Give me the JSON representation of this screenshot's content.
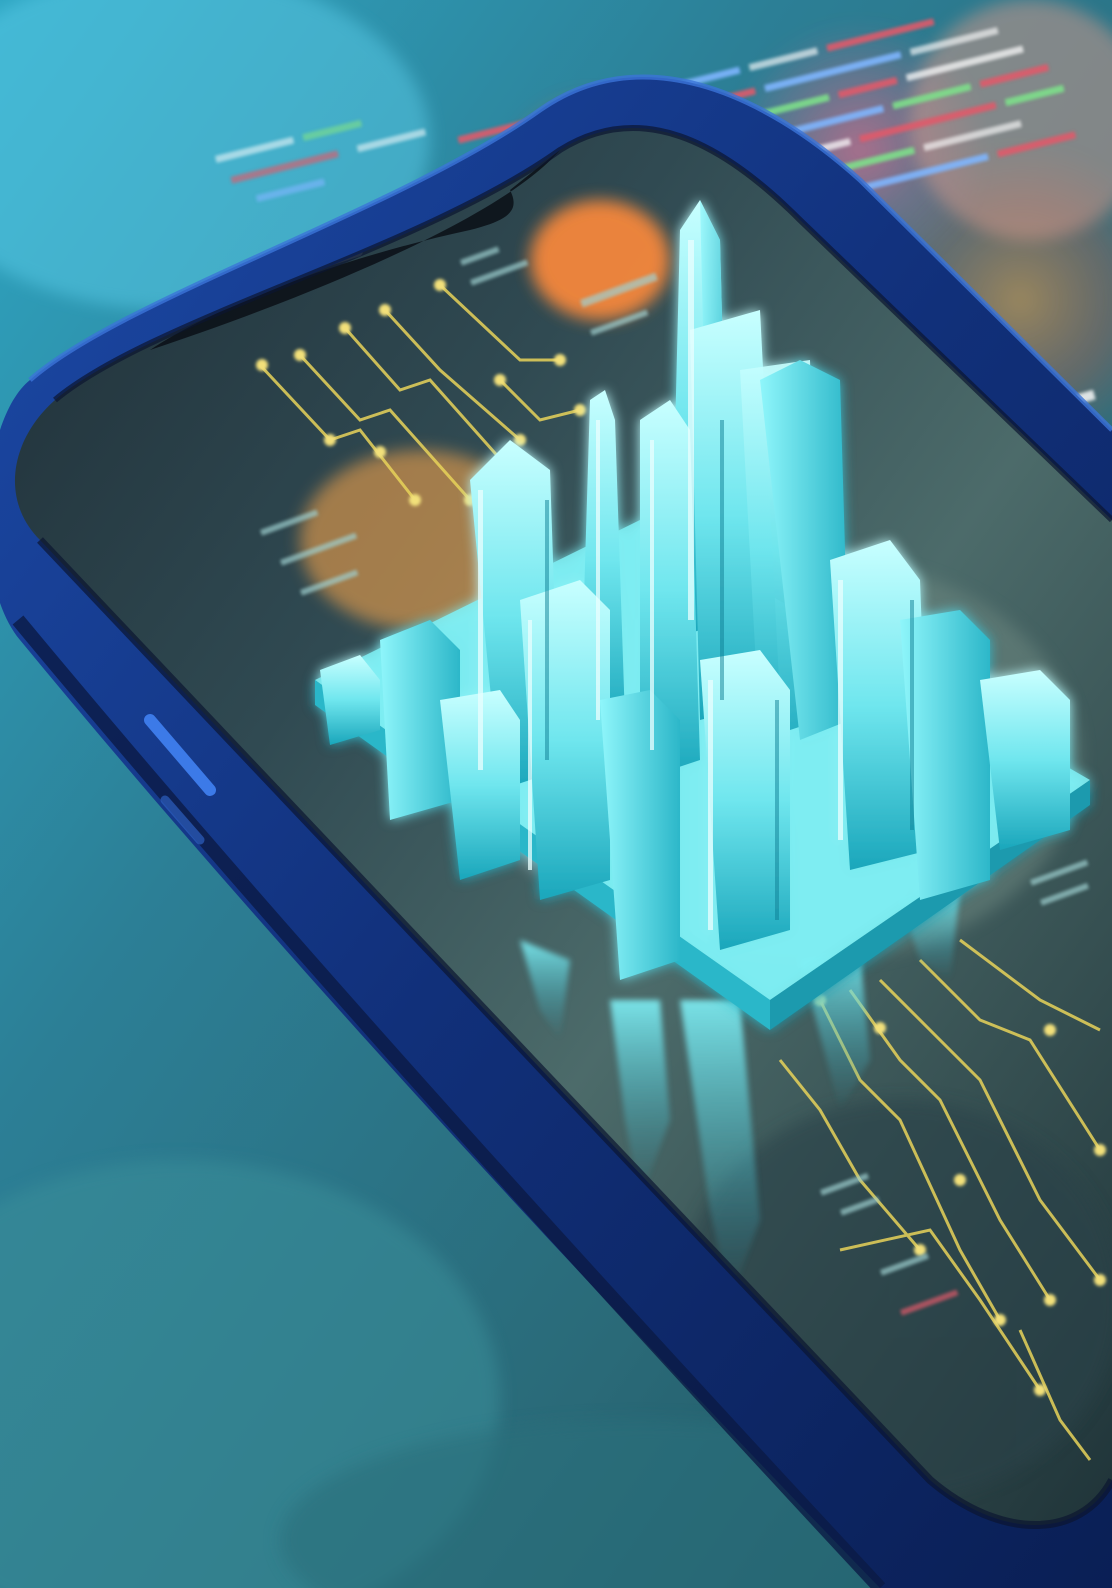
{
  "image": {
    "subject": "smartphone-with-holographic-city",
    "elements": [
      "background-bokeh",
      "code-lines",
      "smartphone",
      "phone-screen",
      "circuit-traces",
      "holographic-city",
      "city-reflection"
    ],
    "colors": {
      "background_teal": "#2f8a9a",
      "background_blue": "#1d4f6a",
      "warm_orange": "#e0783a",
      "phone_frame": "#143a8a",
      "phone_edge_highlight": "#3b74d8",
      "screen_dark": "#17212b",
      "hologram_cyan": "#6ff0f0",
      "hologram_deep": "#1fb9c8",
      "circuit_yellow": "#e8d35a",
      "code_red": "#e05a6a",
      "code_green": "#7ee08a",
      "code_blue": "#7fb6ff"
    }
  }
}
